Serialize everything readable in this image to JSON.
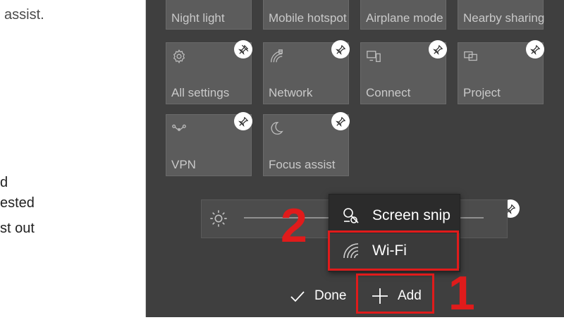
{
  "left_pane": {
    "lines": [
      "assist.",
      "d",
      "ested",
      "st out"
    ]
  },
  "tiles": [
    {
      "label": "Night light",
      "icon": "none"
    },
    {
      "label": "Mobile hotspot",
      "icon": "none"
    },
    {
      "label": "Airplane mode",
      "icon": "none"
    },
    {
      "label": "Nearby sharing",
      "icon": "none"
    },
    {
      "label": "All settings",
      "icon": "gear-icon"
    },
    {
      "label": "Network",
      "icon": "network-icon"
    },
    {
      "label": "Connect",
      "icon": "connect-icon"
    },
    {
      "label": "Project",
      "icon": "project-icon"
    },
    {
      "label": "VPN",
      "icon": "vpn-icon"
    },
    {
      "label": "Focus assist",
      "icon": "moon-icon"
    }
  ],
  "brightness": {
    "icon": "sun-icon"
  },
  "add_menu": {
    "items": [
      {
        "label": "Screen snip",
        "icon": "screen-snip-icon"
      },
      {
        "label": "Wi-Fi",
        "icon": "wifi-icon"
      }
    ]
  },
  "footer": {
    "done_label": "Done",
    "add_label": "Add"
  },
  "annotations": {
    "step1": "1",
    "step2": "2",
    "color": "#e01b1b"
  },
  "colors": {
    "panel_bg": "#3f3f3f",
    "tile_bg": "#5c5c5c",
    "menu_bg": "#2b2b2b"
  }
}
